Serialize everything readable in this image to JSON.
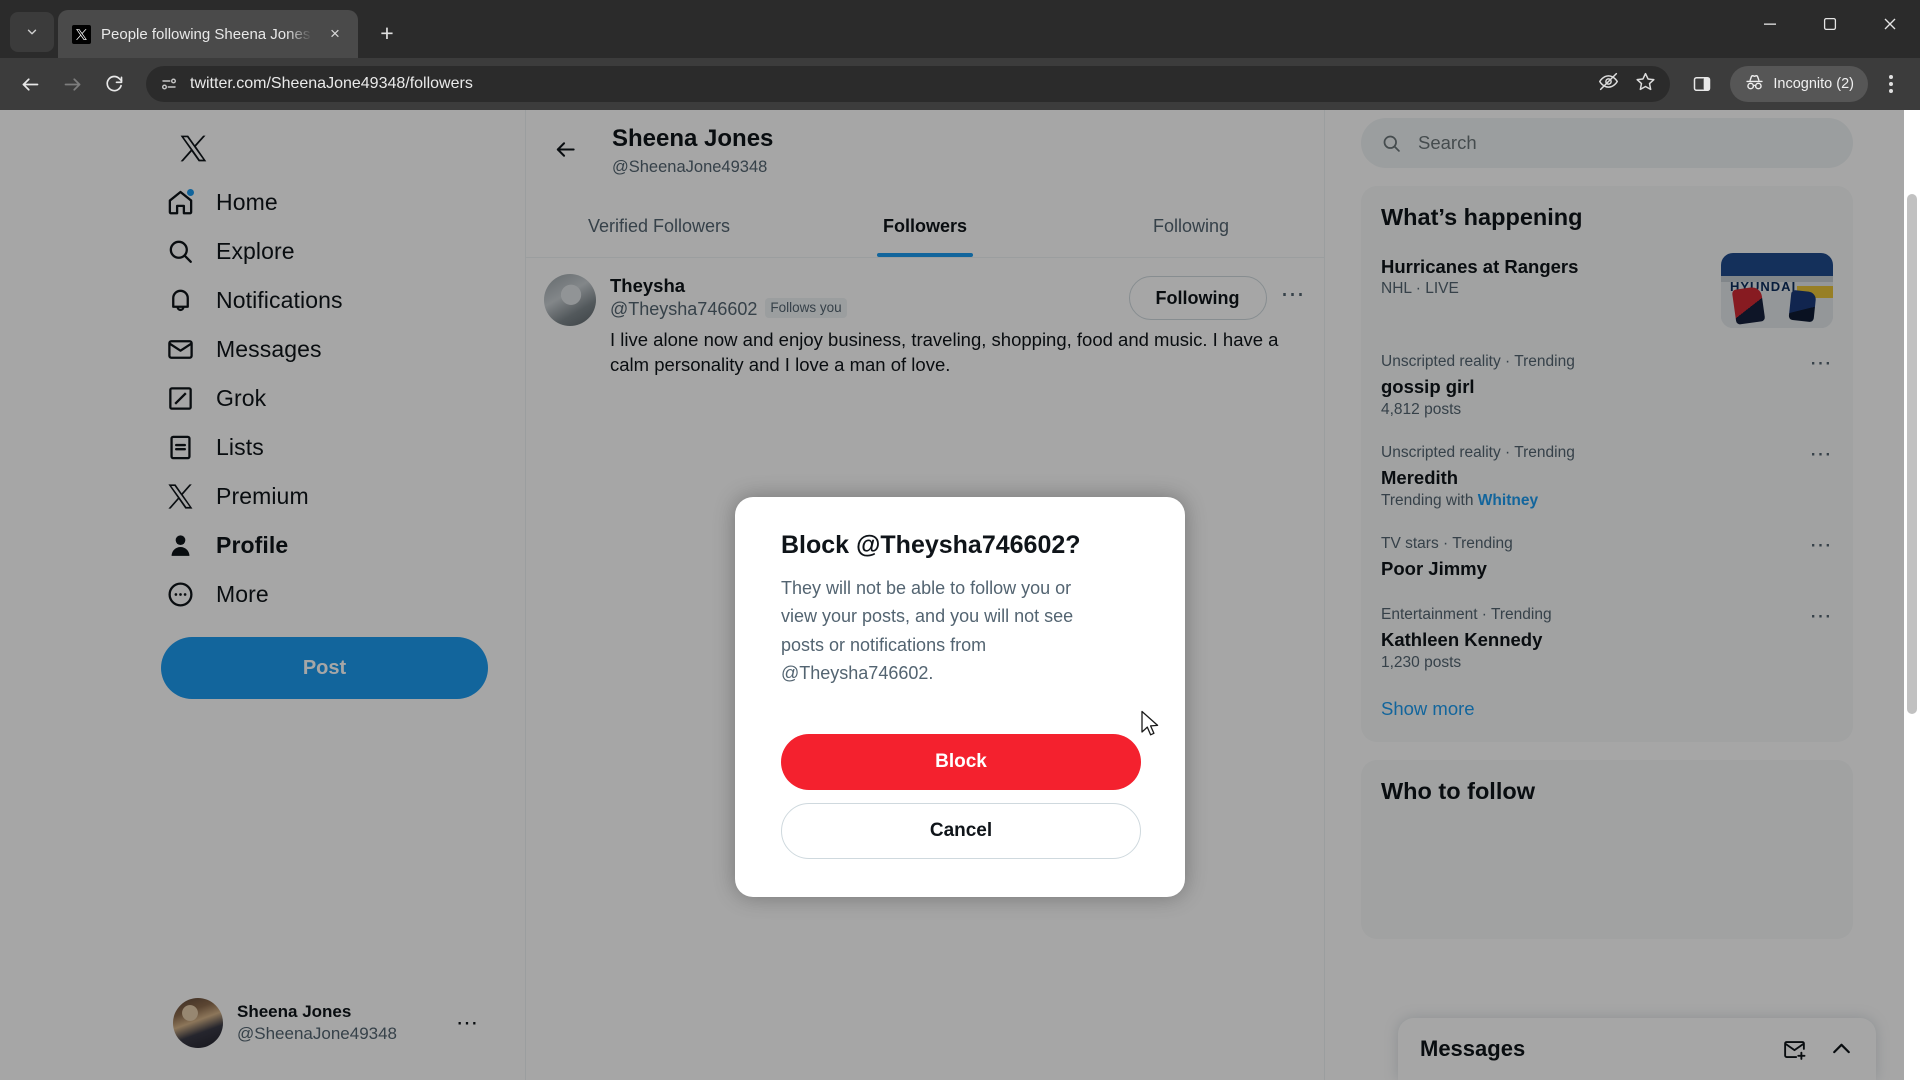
{
  "browser": {
    "tab": {
      "title": "People following Sheena Jones",
      "favicon": "x-logo-icon",
      "close": "×"
    },
    "new_tab_label": "+",
    "tab_search_icon": "chevron-down-icon",
    "window": {
      "minimize": "—",
      "maximize": "❐",
      "close": "✕"
    },
    "nav": {
      "back": "←",
      "forward": "→",
      "reload": "⟳"
    },
    "omnibox": {
      "url": "twitter.com/SheenaJone49348/followers",
      "site_icon": "page-info-icon",
      "hide_icon": "eye-off-icon",
      "bookmark_icon": "star-icon",
      "sidepanel_icon": "side-panel-icon"
    },
    "incognito": {
      "label": "Incognito (2)",
      "icon": "incognito-icon"
    },
    "menu_icon": "three-dot-menu-icon"
  },
  "sidebar": {
    "logo": "x-logo-icon",
    "items": [
      {
        "label": "Home",
        "icon": "home-icon",
        "active": false,
        "badge": true
      },
      {
        "label": "Explore",
        "icon": "search-icon",
        "active": false,
        "badge": false
      },
      {
        "label": "Notifications",
        "icon": "bell-icon",
        "active": false,
        "badge": false
      },
      {
        "label": "Messages",
        "icon": "envelope-icon",
        "active": false,
        "badge": false
      },
      {
        "label": "Grok",
        "icon": "grok-icon",
        "active": false,
        "badge": false
      },
      {
        "label": "Lists",
        "icon": "lists-icon",
        "active": false,
        "badge": false
      },
      {
        "label": "Premium",
        "icon": "x-logo-icon",
        "active": false,
        "badge": false
      },
      {
        "label": "Profile",
        "icon": "person-icon",
        "active": true,
        "badge": false
      },
      {
        "label": "More",
        "icon": "more-circle-icon",
        "active": false,
        "badge": false
      }
    ],
    "post_button": "Post",
    "account": {
      "name": "Sheena Jones",
      "handle": "@SheenaJone49348",
      "menu_icon": "three-dot-menu-icon"
    }
  },
  "main": {
    "back_icon": "arrow-left-icon",
    "profile": {
      "name": "Sheena Jones",
      "handle": "@SheenaJone49348"
    },
    "tabs": [
      {
        "label": "Verified Followers",
        "active": false
      },
      {
        "label": "Followers",
        "active": true
      },
      {
        "label": "Following",
        "active": false
      }
    ],
    "user_cell": {
      "name": "Theysha",
      "handle": "@Theysha746602",
      "follows_you": "Follows you",
      "follow_button": "Following",
      "more_icon": "three-dot-menu-icon",
      "bio": "I live alone now and enjoy business, traveling, shopping, food and music. I have a calm personality and I love a man of love."
    }
  },
  "right": {
    "search": {
      "placeholder": "Search",
      "icon": "search-icon"
    },
    "whats_happening": {
      "title": "What’s happening",
      "trends": [
        {
          "meta": "NHL · LIVE",
          "name": "Hurricanes at Rangers",
          "posts": "",
          "with": "",
          "with_link": "",
          "has_thumb": true,
          "thumb_text": "HYUNDAI",
          "more_icon": ""
        },
        {
          "meta": "Unscripted reality · Trending",
          "name": "gossip girl",
          "posts": "4,812 posts",
          "with": "",
          "with_link": "",
          "has_thumb": false,
          "more_icon": "three-dot-menu-icon"
        },
        {
          "meta": "Unscripted reality · Trending",
          "name": "Meredith",
          "posts": "",
          "with": "Trending with",
          "with_link": "Whitney",
          "has_thumb": false,
          "more_icon": "three-dot-menu-icon"
        },
        {
          "meta": "TV stars · Trending",
          "name": "Poor Jimmy",
          "posts": "",
          "with": "",
          "with_link": "",
          "has_thumb": false,
          "more_icon": "three-dot-menu-icon"
        },
        {
          "meta": "Entertainment · Trending",
          "name": "Kathleen Kennedy",
          "posts": "1,230 posts",
          "with": "",
          "with_link": "",
          "has_thumb": false,
          "more_icon": "three-dot-menu-icon"
        }
      ],
      "show_more": "Show more"
    },
    "who_to_follow": {
      "title": "Who to follow"
    }
  },
  "messages_dock": {
    "title": "Messages",
    "compose_icon": "new-message-icon",
    "expand_icon": "chevron-up-icon"
  },
  "modal": {
    "title": "Block @Theysha746602?",
    "body": "They will not be able to follow you or view your posts, and you will not see posts or notifications from @Theysha746602.",
    "block_button": "Block",
    "cancel_button": "Cancel"
  },
  "colors": {
    "accent_blue": "#1d9bf0",
    "danger_red": "#f4212e",
    "text_primary": "#0f1419",
    "text_secondary": "#536471"
  }
}
